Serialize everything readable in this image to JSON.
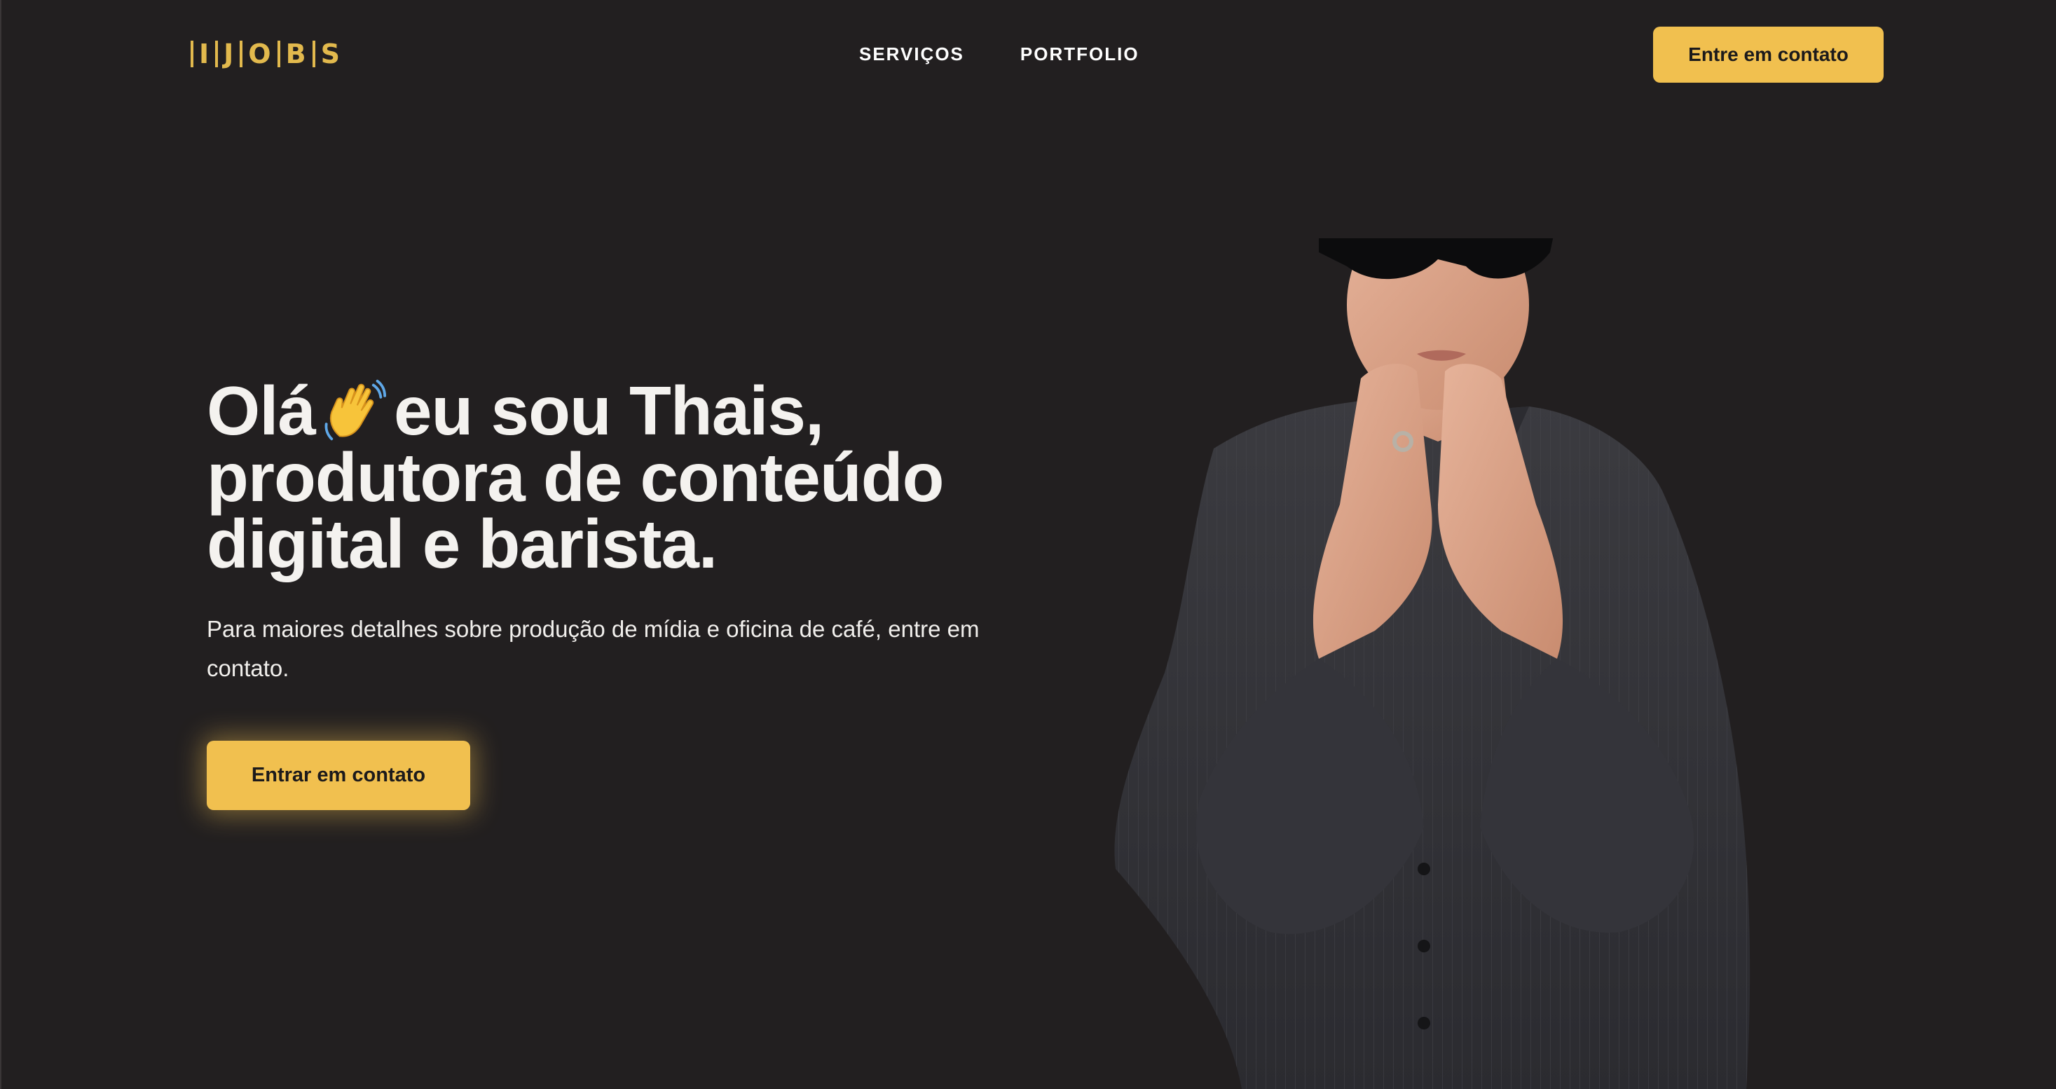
{
  "header": {
    "logo_letters": [
      "I",
      "J",
      "O",
      "B",
      "S"
    ],
    "nav": [
      {
        "label": "SERVIÇOS"
      },
      {
        "label": "PORTFOLIO"
      }
    ],
    "cta_label": "Entre em contato"
  },
  "hero": {
    "title_lines": [
      "Olá",
      "eu sou Thais,",
      "produtora de conteúdo",
      "digital e barista."
    ],
    "subtitle": "Para maiores detalhes sobre produção de mídia e oficina de café, entre em contato.",
    "cta_label": "Entrar em contato"
  },
  "icons": {
    "wave": "waving-hand-icon"
  },
  "colors": {
    "background": "#221f20",
    "accent": "#f1c04f",
    "logo": "#e2b94d",
    "text": "#f4f2ef",
    "button_text": "#1c1a1b"
  }
}
